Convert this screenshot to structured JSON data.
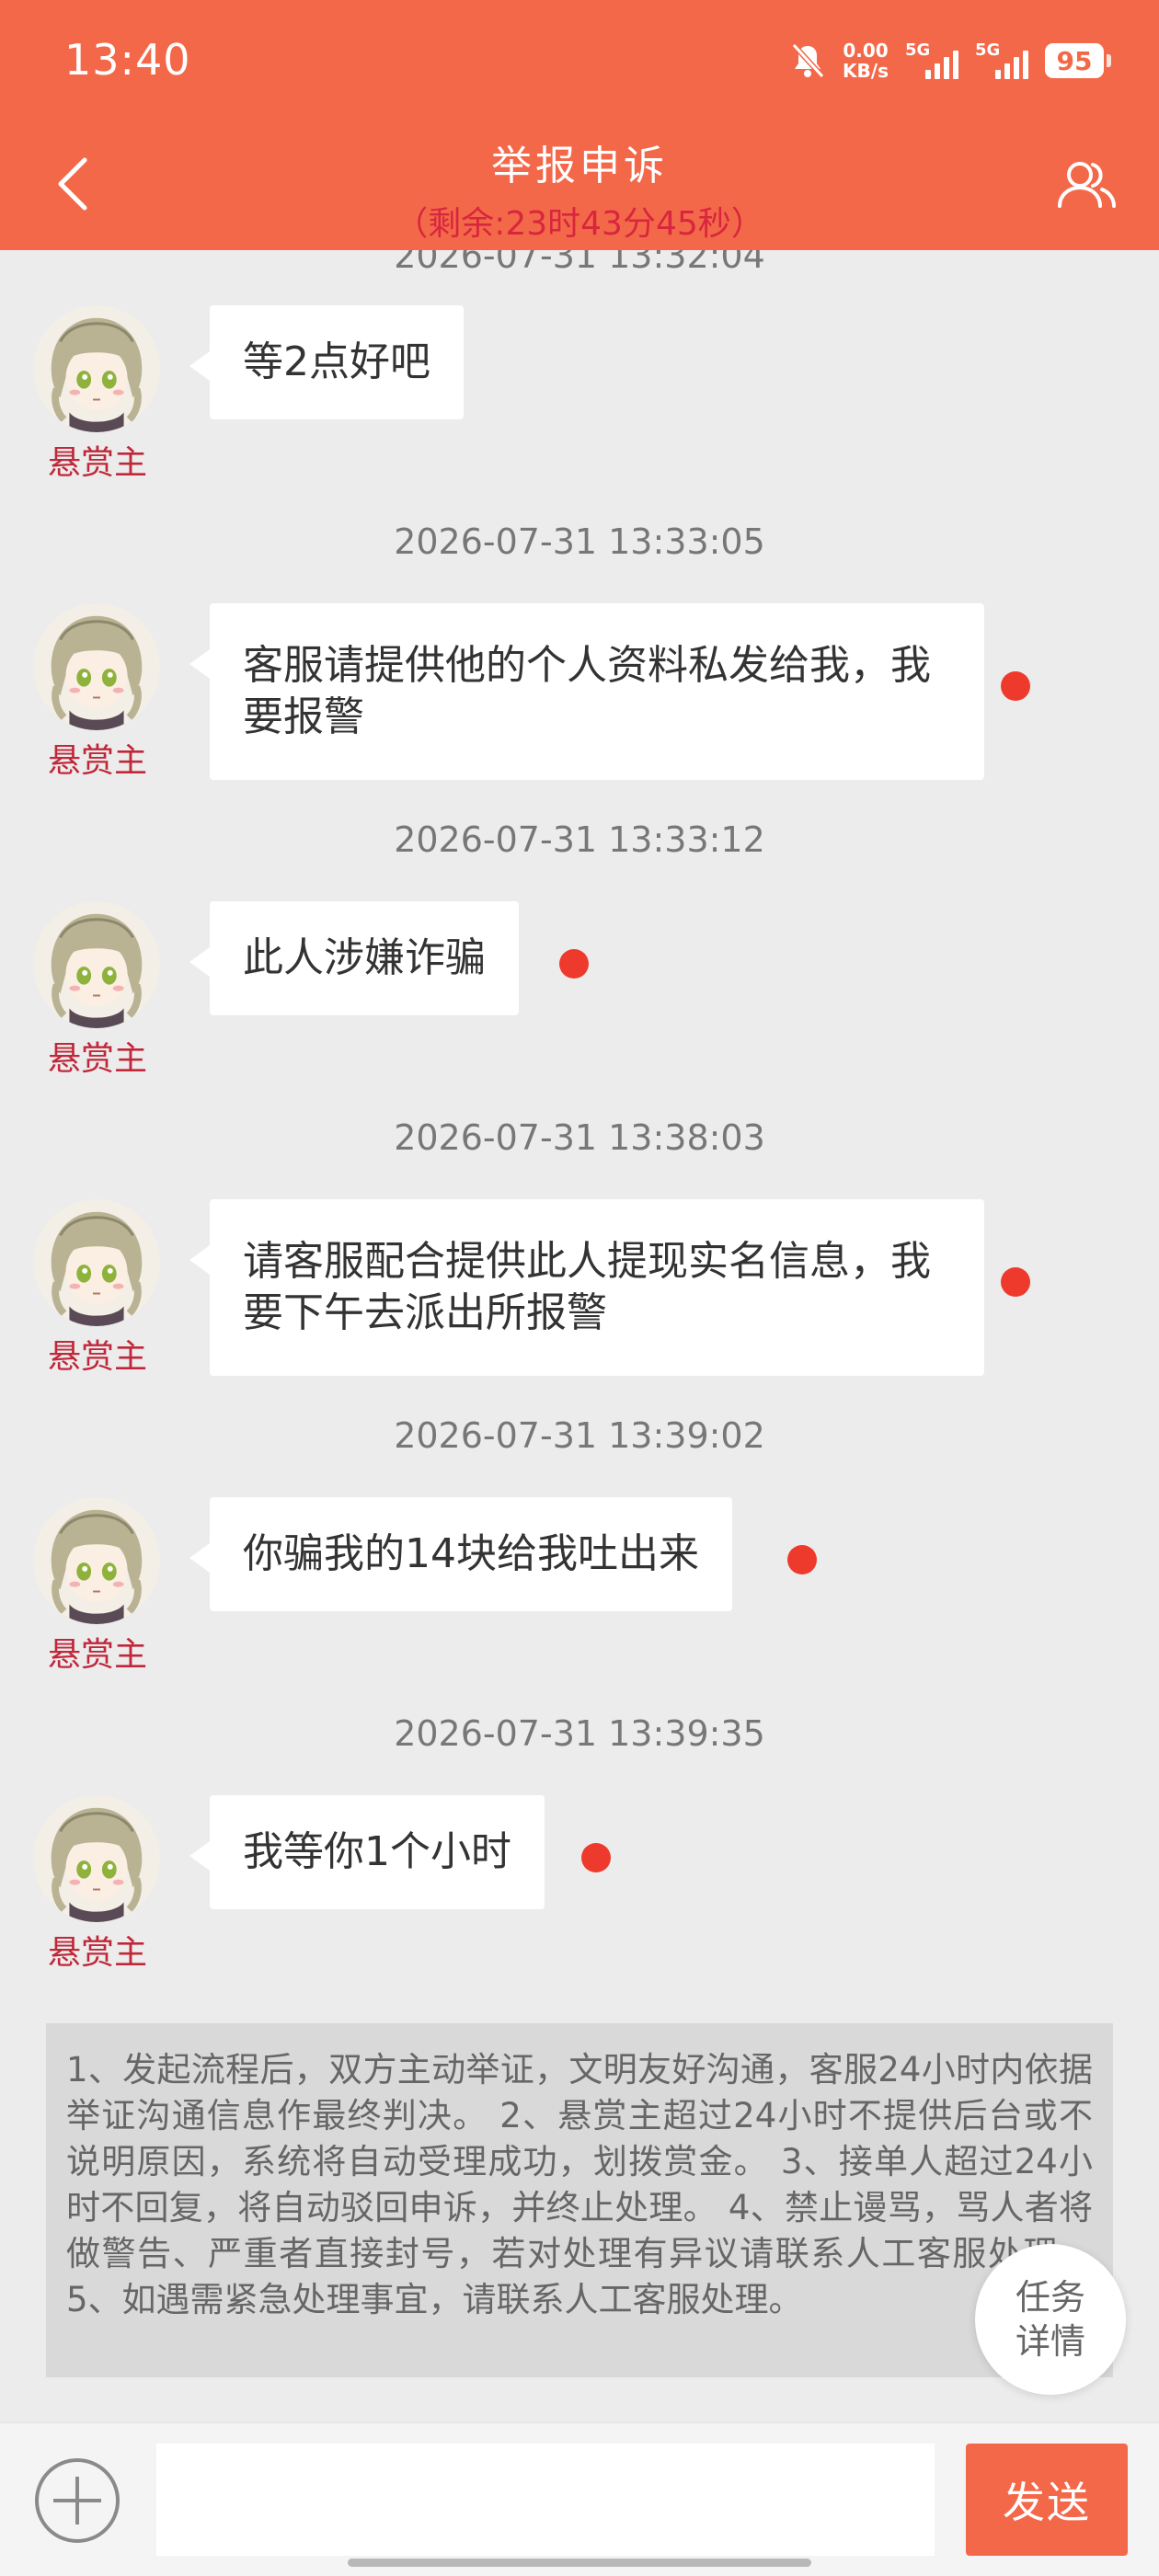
{
  "status_bar": {
    "time": "13:40",
    "net_speed": "0.00",
    "net_unit": "KB/s",
    "sim1": "5G",
    "sim2": "5G",
    "battery": "95"
  },
  "header": {
    "title": "举报申诉",
    "countdown": "（剩余:23时43分45秒）",
    "back_icon": "chevron-left-icon",
    "user_icon": "users-icon"
  },
  "colors": {
    "accent": "#f4684a",
    "role_text": "#c0283a",
    "unread_dot": "#ee3a2c"
  },
  "chat": {
    "partial_timestamp": "2026-07-31 13:32:04",
    "messages": [
      {
        "timestamp": "",
        "sender": "悬赏主",
        "text": "等2点好吧",
        "dot": false
      },
      {
        "timestamp": "2026-07-31 13:33:05",
        "sender": "悬赏主",
        "text": "客服请提供他的个人资料私发给我，我要报警",
        "dot": true
      },
      {
        "timestamp": "2026-07-31 13:33:12",
        "sender": "悬赏主",
        "text": "此人涉嫌诈骗",
        "dot": true
      },
      {
        "timestamp": "2026-07-31 13:38:03",
        "sender": "悬赏主",
        "text": "请客服配合提供此人提现实名信息，我要下午去派出所报警",
        "dot": true
      },
      {
        "timestamp": "2026-07-31 13:39:02",
        "sender": "悬赏主",
        "text": "你骗我的14块给我吐出来",
        "dot": true
      },
      {
        "timestamp": "2026-07-31 13:39:35",
        "sender": "悬赏主",
        "text": "我等你1个小时",
        "dot": true
      }
    ]
  },
  "rules_text": "1、发起流程后，双方主动举证，文明友好沟通，客服24小时内依据举证沟通信息作最终判决。 2、悬赏主超过24小时不提供后台或不说明原因，系统将自动受理成功，划拨赏金。 3、接单人超过24小时不回复，将自动驳回申诉，并终止处理。 4、禁止谩骂，骂人者将做警告、严重者直接封号，若对处理有异议请联系人工客服处理。 5、如遇需紧急处理事宜，请联系人工客服处理。",
  "task_button": {
    "line1": "任务",
    "line2": "详情"
  },
  "input_bar": {
    "add_icon": "plus-circle-icon",
    "input_value": "",
    "send_label": "发送"
  }
}
